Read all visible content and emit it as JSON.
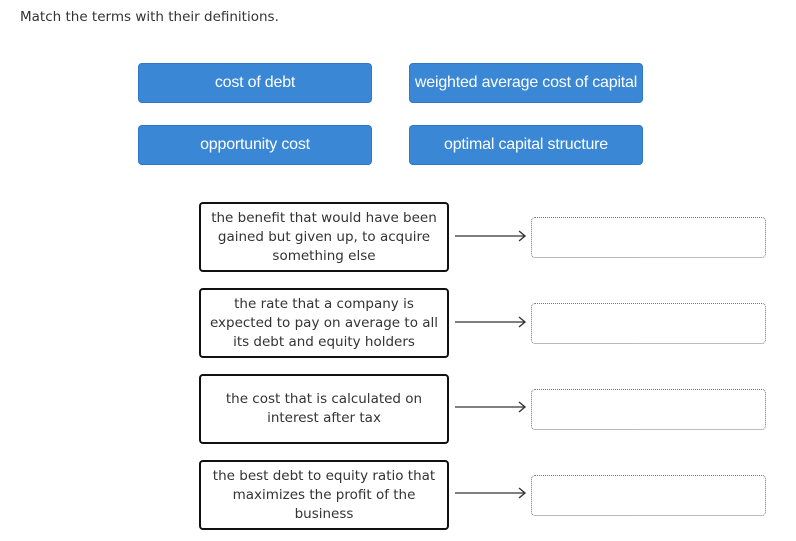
{
  "instruction": "Match the terms with their definitions.",
  "terms": [
    {
      "label": "cost of debt"
    },
    {
      "label": "weighted average cost of capital"
    },
    {
      "label": "opportunity cost"
    },
    {
      "label": "optimal capital structure"
    }
  ],
  "definitions": [
    {
      "text": "the benefit that would have been gained but given up, to acquire something else",
      "answer": ""
    },
    {
      "text": "the rate that a company is expected to pay on average to all its debt and equity holders",
      "answer": ""
    },
    {
      "text": "the cost that is calculated on interest after tax",
      "answer": ""
    },
    {
      "text": "the best debt to equity ratio that maximizes the profit of the business",
      "answer": ""
    }
  ],
  "colors": {
    "term_bg": "#3a87d6"
  }
}
